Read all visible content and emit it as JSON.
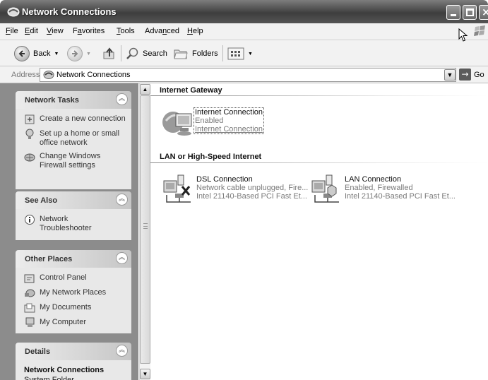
{
  "window": {
    "title": "Network Connections",
    "icon": "network-connections-icon"
  },
  "menu": [
    {
      "label": "File",
      "u": "F",
      "rest": "ile"
    },
    {
      "label": "Edit",
      "u": "E",
      "rest": "dit"
    },
    {
      "label": "View",
      "u": "V",
      "rest": "iew"
    },
    {
      "label": "Favorites",
      "pre": "F",
      "u": "a",
      "rest": "vorites"
    },
    {
      "label": "Tools",
      "u": "T",
      "rest": "ools"
    },
    {
      "label": "Advanced",
      "pre": "Adva",
      "u": "n",
      "rest": "ced"
    },
    {
      "label": "Help",
      "u": "H",
      "rest": "elp"
    }
  ],
  "toolbar": {
    "back_label": "Back",
    "search_label": "Search",
    "folders_label": "Folders"
  },
  "address": {
    "label": "Address",
    "value": "Network Connections",
    "go_label": "Go"
  },
  "taskpane": {
    "network_tasks": {
      "title": "Network Tasks",
      "items": [
        {
          "label": "Create a new connection",
          "icon": "new-connection-icon"
        },
        {
          "label": "Set up a home or small office network",
          "icon": "home-network-setup-icon"
        },
        {
          "label": "Change Windows Firewall settings",
          "icon": "firewall-icon"
        }
      ]
    },
    "see_also": {
      "title": "See Also",
      "items": [
        {
          "label": "Network Troubleshooter",
          "icon": "info-icon"
        }
      ]
    },
    "other_places": {
      "title": "Other Places",
      "items": [
        {
          "label": "Control Panel",
          "icon": "control-panel-icon"
        },
        {
          "label": "My Network Places",
          "icon": "network-places-icon"
        },
        {
          "label": "My Documents",
          "icon": "documents-folder-icon"
        },
        {
          "label": "My Computer",
          "icon": "computer-icon"
        }
      ]
    },
    "details": {
      "title": "Details",
      "name": "Network Connections",
      "type": "System Folder"
    }
  },
  "groups": {
    "gateway": {
      "title": "Internet Gateway",
      "items": [
        {
          "name": "Internet Connection",
          "status": "Enabled",
          "device": "Internet Connection"
        }
      ]
    },
    "lan": {
      "title": "LAN or High-Speed Internet",
      "items": [
        {
          "name": "DSL Connection",
          "status": "Network cable unplugged, Fire...",
          "device": "Intel 21140-Based PCI Fast Et..."
        },
        {
          "name": "LAN Connection",
          "status": "Enabled, Firewalled",
          "device": "Intel 21140-Based PCI Fast Et..."
        }
      ]
    }
  }
}
